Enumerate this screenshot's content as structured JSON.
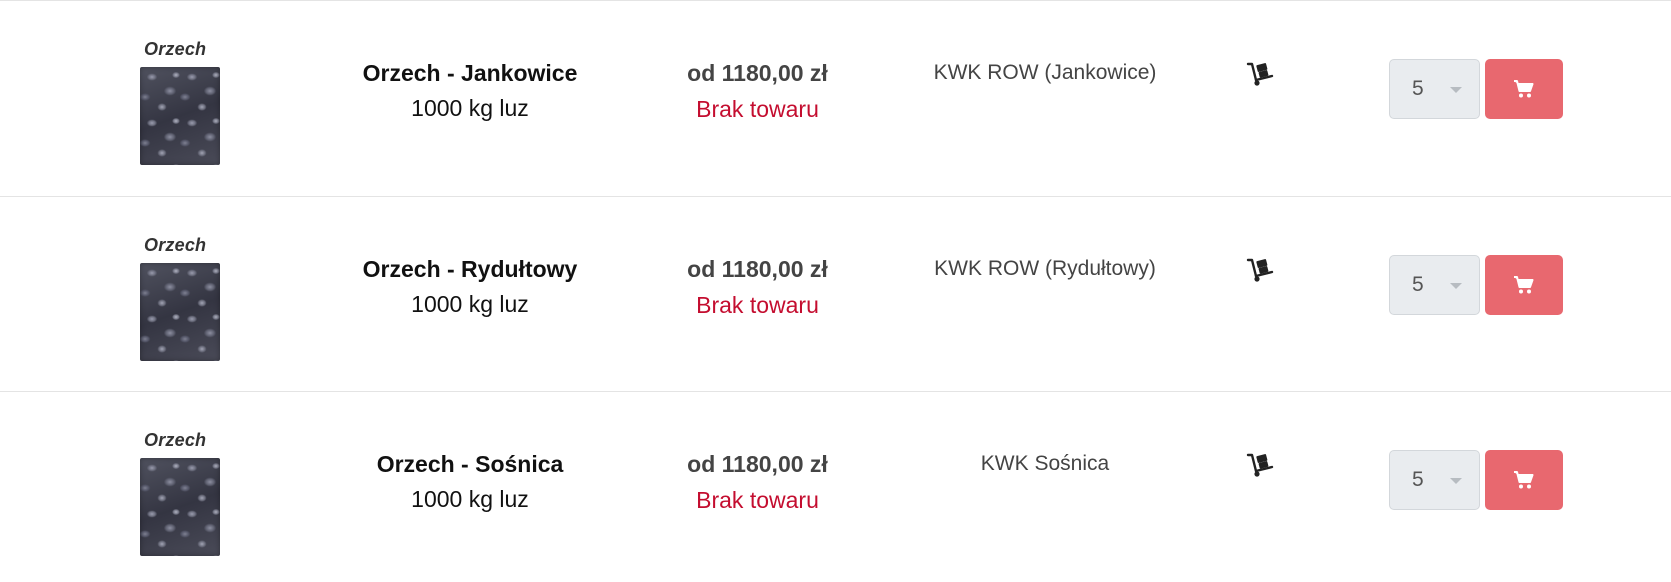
{
  "products": [
    {
      "thumb_label": "Orzech",
      "name": "Orzech - Jankowice",
      "unit": "1000 kg luz",
      "price": "od 1180,00 zł",
      "stock": "Brak towaru",
      "origin": "KWK ROW (Jankowice)",
      "quantity": "5"
    },
    {
      "thumb_label": "Orzech",
      "name": "Orzech - Rydułtowy",
      "unit": "1000 kg luz",
      "price": "od 1180,00 zł",
      "stock": "Brak towaru",
      "origin": "KWK ROW (Rydułtowy)",
      "quantity": "5"
    },
    {
      "thumb_label": "Orzech",
      "name": "Orzech - Sośnica",
      "unit": "1000 kg luz",
      "price": "od 1180,00 zł",
      "stock": "Brak towaru",
      "origin": "KWK Sośnica",
      "quantity": "5"
    }
  ],
  "icons": {
    "delivery": "hand-truck-icon",
    "cart": "shopping-cart-icon"
  },
  "colors": {
    "stock_out": "#c40d2f",
    "cart_button": "#e8686f",
    "qty_bg": "#e9ecef"
  }
}
